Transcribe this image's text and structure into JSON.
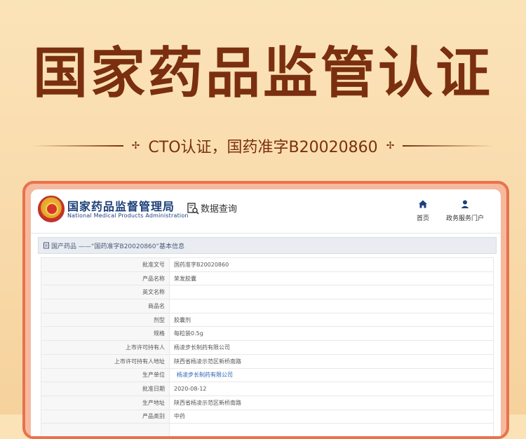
{
  "banner": {
    "headline": "国家药品监管认证",
    "subtext": "CTO认证，国药准字B20020860"
  },
  "site": {
    "title": "国家药品监督管理局",
    "subtitle": "National Medical Products Administration",
    "query_label": "数据查询",
    "nav": [
      {
        "label": "首页",
        "icon": "home-icon"
      },
      {
        "label": "政务服务门户",
        "icon": "user-icon"
      }
    ]
  },
  "breadcrumb": "国产药品 ——“国药准字B20020860”基本信息",
  "table": {
    "rows": [
      {
        "label": "批准文号",
        "value": "国药准字B20020860"
      },
      {
        "label": "产品名称",
        "value": "荣发胶囊"
      },
      {
        "label": "英文名称",
        "value": ""
      },
      {
        "label": "商品名",
        "value": ""
      },
      {
        "label": "剂型",
        "value": "胶囊剂"
      },
      {
        "label": "规格",
        "value": "每粒装0.5g"
      },
      {
        "label": "上市许可持有人",
        "value": "杨凌步长制药有限公司"
      },
      {
        "label": "上市许可持有人地址",
        "value": "陕西省杨凌示范区新桥南路"
      },
      {
        "label": "生产单位",
        "value": "杨凌步长制药有限公司",
        "link": true
      },
      {
        "label": "批准日期",
        "value": "2020-08-12"
      },
      {
        "label": "生产地址",
        "value": "陕西省杨凌示范区新桥南路"
      },
      {
        "label": "产品类别",
        "value": "中药"
      },
      {
        "label": "",
        "value": ""
      }
    ]
  },
  "colors": {
    "headline": "#7a2f10",
    "frame": "#e8724c",
    "site_title": "#1d3f7a",
    "link": "#2b63b6"
  }
}
